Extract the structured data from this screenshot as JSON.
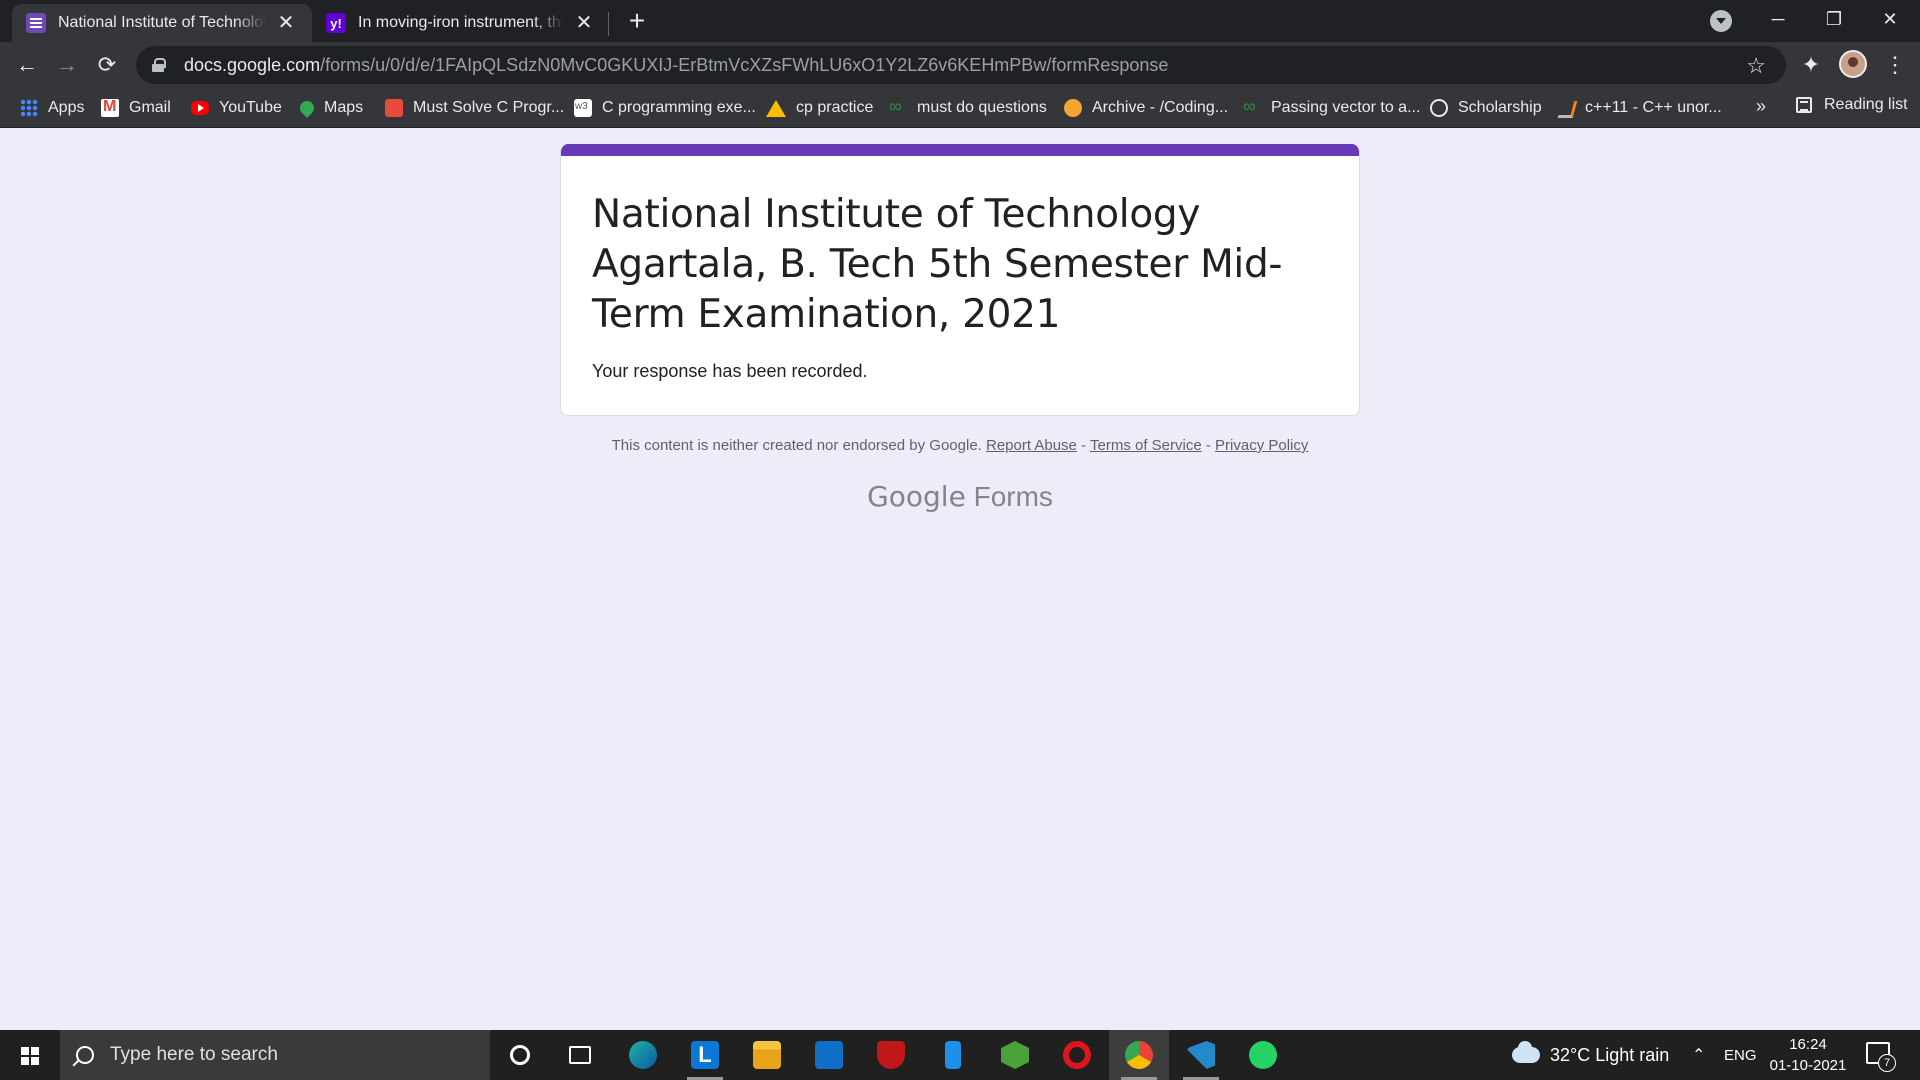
{
  "browser": {
    "tabs": [
      {
        "title": "National Institute of Technology Agartala",
        "favicon": "google-forms-icon",
        "active": true
      },
      {
        "title": "In moving-iron instrument, the deflecting",
        "favicon": "yahoo-icon",
        "active": false
      }
    ],
    "url_host": "docs.google.com",
    "url_path": "/forms/u/0/d/e/1FAIpQLSdzN0MvC0GKUXIJ-ErBtmVcXZsFWhLU6xO1Y2LZ6v6KEHmPBw/formResponse",
    "bookmarks": [
      {
        "label": "Apps",
        "icon": "apps-grid-icon"
      },
      {
        "label": "Gmail",
        "icon": "gmail-icon"
      },
      {
        "label": "YouTube",
        "icon": "youtube-icon"
      },
      {
        "label": "Maps",
        "icon": "maps-icon"
      },
      {
        "label": "Must Solve C Progr...",
        "icon": "bookmark-red-icon"
      },
      {
        "label": "C programming exe...",
        "icon": "w3resource-icon"
      },
      {
        "label": "cp practice",
        "icon": "google-drive-icon"
      },
      {
        "label": "must do questions",
        "icon": "geeksforgeeks-icon"
      },
      {
        "label": "Archive - /Coding...",
        "icon": "archive-icon"
      },
      {
        "label": "Passing vector to a...",
        "icon": "geeksforgeeks-icon"
      },
      {
        "label": "Scholarship",
        "icon": "globe-icon"
      },
      {
        "label": "c++11 - C++ unor...",
        "icon": "stackoverflow-icon"
      }
    ],
    "bookmarks_overflow": "»",
    "reading_list": "Reading list"
  },
  "form": {
    "title": "National Institute of Technology Agartala, B. Tech 5th Semester Mid-Term Examination, 2021",
    "confirmation": "Your response has been recorded.",
    "accent_color": "#673ab7",
    "footer_text": "This content is neither created nor endorsed by Google.",
    "links": {
      "report_abuse": "Report Abuse",
      "terms": "Terms of Service",
      "privacy": "Privacy Policy"
    },
    "sep": "-",
    "brand_google": "Google",
    "brand_forms": "Forms"
  },
  "taskbar": {
    "search_placeholder": "Type here to search",
    "weather": "32°C  Light rain",
    "language": "ENG",
    "time": "16:24",
    "date": "01-10-2021",
    "notifications": "7"
  }
}
